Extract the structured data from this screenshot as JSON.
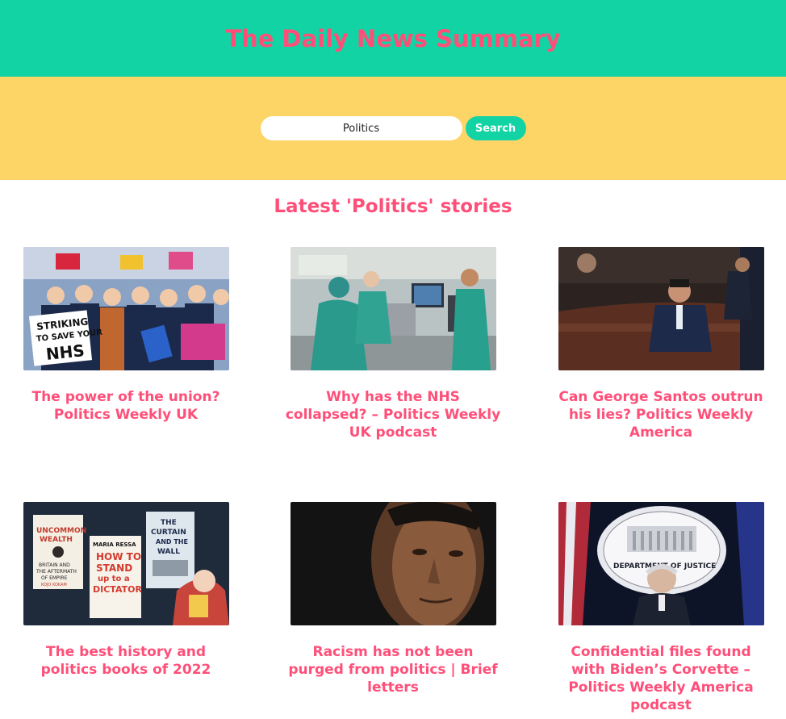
{
  "header": {
    "title": "The Daily News Summary"
  },
  "search": {
    "value": "Politics",
    "button_label": "Search"
  },
  "section": {
    "heading": "Latest 'Politics' stories"
  },
  "stories": [
    {
      "title": "The power of the union? Politics Weekly UK",
      "image": "nurses-strike-photo"
    },
    {
      "title": "Why has the NHS collapsed? – Politics Weekly UK podcast",
      "image": "hospital-ward-photo"
    },
    {
      "title": "Can George Santos outrun his lies? Politics Weekly America",
      "image": "congress-chamber-photo"
    },
    {
      "title": "The best history and politics books of 2022",
      "image": "book-covers-illustration"
    },
    {
      "title": "Racism has not been purged from politics | Brief letters",
      "image": "portrait-photo"
    },
    {
      "title": "Confidential files found with Biden’s Corvette – Politics Weekly America podcast",
      "image": "justice-department-podium-photo"
    }
  ],
  "thumb_texts": {
    "strike_sign": [
      "STRIKING",
      "TO SAVE YOUR",
      "NHS"
    ],
    "book1": [
      "UNCOMMON",
      "WEALTH",
      "BRITAIN AND",
      "THE AFTERMATH",
      "OF EMPIRE",
      "KOJO KOKAM"
    ],
    "book2": [
      "MARIA RESSA",
      "HOW TO",
      "STAND",
      "up to a",
      "DICTATOR"
    ],
    "book3": [
      "THE",
      "CURTAIN",
      "AND THE",
      "WALL"
    ],
    "seal": [
      "DEPARTMENT OF JUSTICE"
    ]
  },
  "colors": {
    "header_bg": "#12d3a4",
    "accent_pink": "#ff4f79",
    "search_band_bg": "#fdd466"
  }
}
